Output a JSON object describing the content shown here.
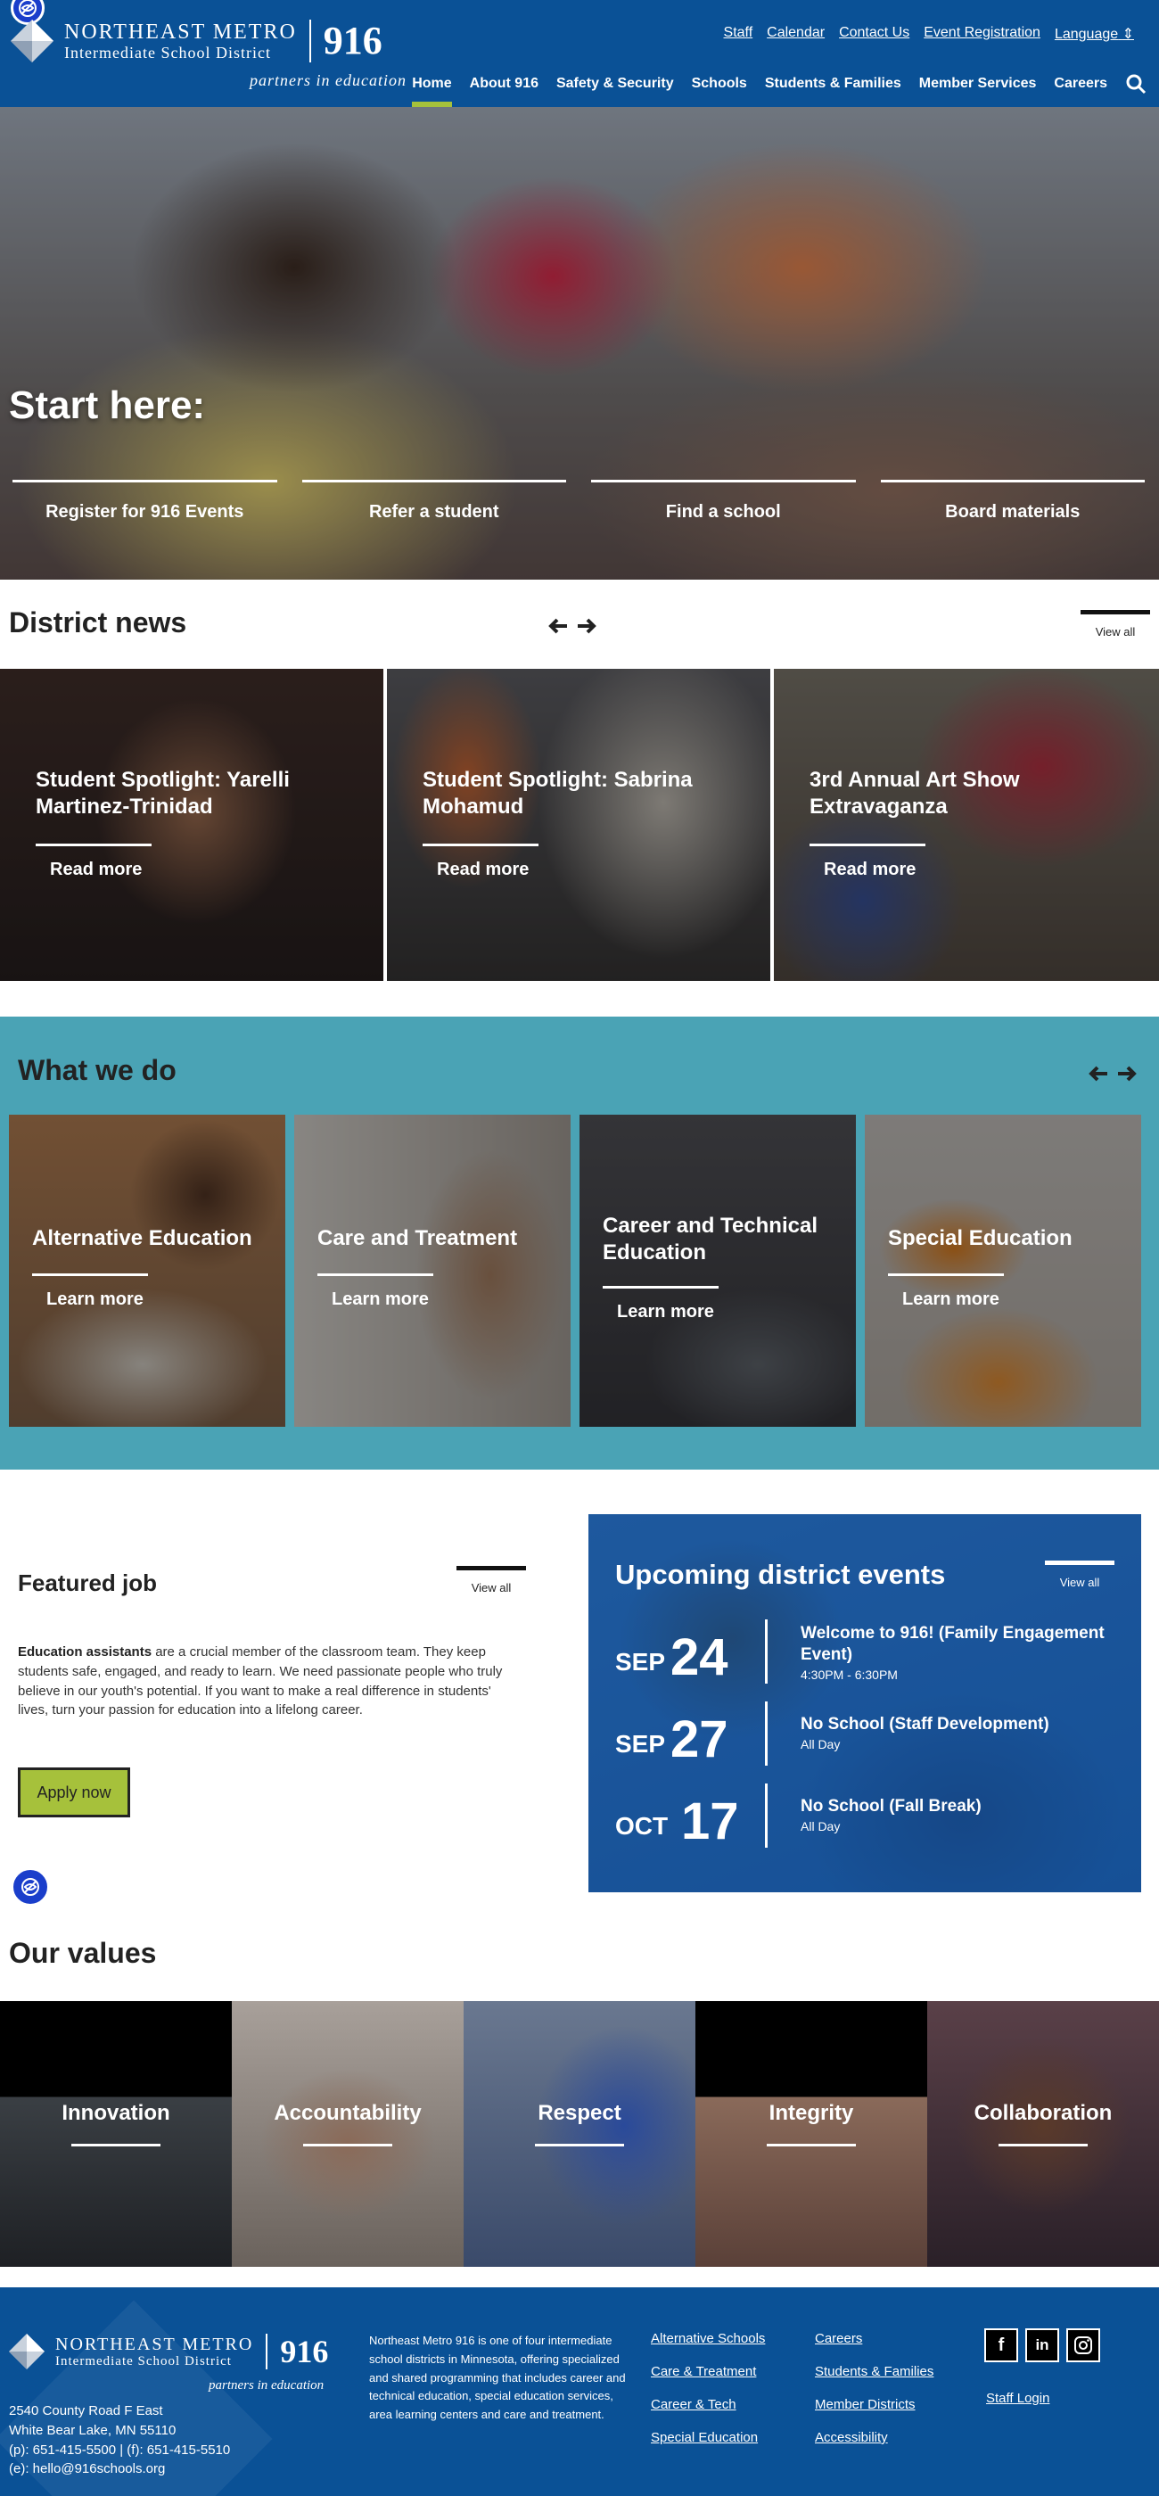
{
  "header": {
    "logo_line1": "NORTHEAST METRO",
    "logo_line2": "Intermediate School District",
    "logo_number": "916",
    "tagline": "partners in education",
    "utility_links": [
      "Staff",
      "Calendar",
      "Contact Us",
      "Event Registration",
      "Language"
    ],
    "nav": [
      "Home",
      "About 916",
      "Safety & Security",
      "Schools",
      "Students & Families",
      "Member Services",
      "Careers"
    ],
    "active_nav": "Home"
  },
  "hero": {
    "title": "Start here:",
    "links": [
      "Register for 916 Events",
      "Refer a student",
      "Find a school",
      "Board materials"
    ]
  },
  "news": {
    "title": "District news",
    "view_all": "View all",
    "cards": [
      {
        "title": "Student Spotlight: Yarelli Martinez-Trinidad",
        "more": "Read more"
      },
      {
        "title": "Student Spotlight: Sabrina Mohamud",
        "more": "Read more"
      },
      {
        "title": "3rd Annual Art Show Extravaganza",
        "more": "Read more"
      }
    ]
  },
  "whatwedo": {
    "title": "What we do",
    "cards": [
      {
        "title": "Alternative Education",
        "more": "Learn more"
      },
      {
        "title": "Care and Treatment",
        "more": "Learn more"
      },
      {
        "title": "Career and Technical Education",
        "more": "Learn more"
      },
      {
        "title": "Special Education",
        "more": "Learn more"
      }
    ]
  },
  "job": {
    "title": "Featured job",
    "view_all": "View all",
    "lead": "Education assistants",
    "body": " are a crucial member of the classroom team. They keep students safe, engaged, and ready to learn. We need passionate people who truly believe in our youth's potential. If you want to make a real difference in students' lives, turn your passion for education into a lifelong career.",
    "apply": "Apply now"
  },
  "events": {
    "title": "Upcoming district events",
    "view_all": "View all",
    "items": [
      {
        "month": "SEP",
        "day": "24",
        "name": "Welcome to 916! (Family Engagement Event)",
        "time": "4:30PM - 6:30PM"
      },
      {
        "month": "SEP",
        "day": "27",
        "name": "No School (Staff Development)",
        "time": "All Day"
      },
      {
        "month": "OCT",
        "day": "17",
        "name": "No School (Fall Break)",
        "time": "All Day"
      }
    ]
  },
  "values": {
    "title": "Our values",
    "items": [
      "Innovation",
      "Accountability",
      "Respect",
      "Integrity",
      "Collaboration"
    ]
  },
  "footer": {
    "address": [
      "2540 County Road F East",
      "White Bear Lake, MN 55110",
      "(p): 651-415-5500 | (f): 651-415-5510",
      "(e): hello@916schools.org"
    ],
    "about": "Northeast Metro 916 is one of four intermediate school districts in Minnesota, offering specialized and shared programming that includes career and technical education, special education services, area learning centers and care and treatment.",
    "col1": [
      "Alternative Schools",
      "Care & Treatment",
      "Career & Tech",
      "Special Education"
    ],
    "col2": [
      "Careers",
      "Students & Families",
      "Member Districts",
      "Accessibility"
    ],
    "socials": [
      "f",
      "in",
      "ig"
    ],
    "staff_login": "Staff Login"
  }
}
